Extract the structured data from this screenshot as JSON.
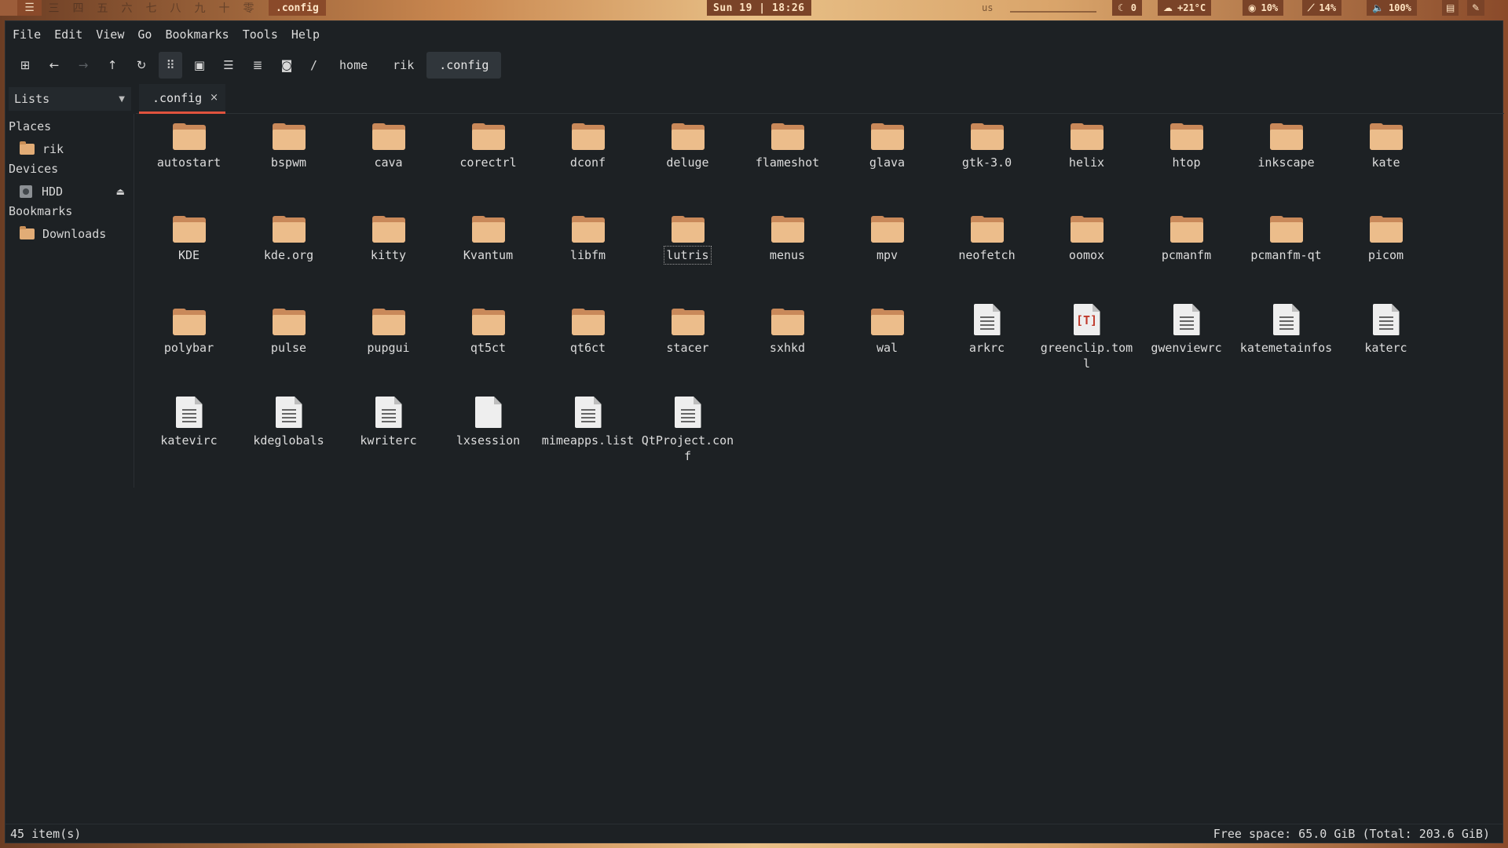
{
  "panel": {
    "workspaces": [
      "三",
      "四",
      "五",
      "六",
      "七",
      "八",
      "九",
      "十",
      "零"
    ],
    "window_title": ".config",
    "clock": "Sun 19 | 18:26",
    "keyboard": "us",
    "stats": [
      {
        "icon": "moon-icon",
        "glyph": "☾",
        "value": "0"
      },
      {
        "icon": "weather-icon",
        "glyph": "☁",
        "value": "+21°C"
      },
      {
        "icon": "cpu-icon",
        "glyph": "◉",
        "value": "10%"
      },
      {
        "icon": "memory-icon",
        "glyph": "⟋",
        "value": "14%"
      },
      {
        "icon": "volume-icon",
        "glyph": "🔈",
        "value": "100%"
      }
    ]
  },
  "menubar": {
    "file": "File",
    "edit": "Edit",
    "view": "View",
    "go": "Go",
    "bookmarks": "Bookmarks",
    "tools": "Tools",
    "help": "Help"
  },
  "toolbar": {
    "root": "/",
    "breadcrumbs": [
      "home",
      "rik",
      ".config"
    ]
  },
  "side": {
    "lists_label": "Lists",
    "places_heading": "Places",
    "places": [
      {
        "label": "rik"
      }
    ],
    "devices_heading": "Devices",
    "devices": [
      {
        "label": "HDD"
      }
    ],
    "bookmarks_heading": "Bookmarks",
    "bookmarks": [
      {
        "label": "Downloads"
      }
    ]
  },
  "tab": {
    "label": ".config",
    "close": "×"
  },
  "items": [
    {
      "name": "autostart",
      "type": "folder"
    },
    {
      "name": "bspwm",
      "type": "folder"
    },
    {
      "name": "cava",
      "type": "folder"
    },
    {
      "name": "corectrl",
      "type": "folder"
    },
    {
      "name": "dconf",
      "type": "folder"
    },
    {
      "name": "deluge",
      "type": "folder"
    },
    {
      "name": "flameshot",
      "type": "folder"
    },
    {
      "name": "glava",
      "type": "folder"
    },
    {
      "name": "gtk-3.0",
      "type": "folder"
    },
    {
      "name": "helix",
      "type": "folder"
    },
    {
      "name": "htop",
      "type": "folder"
    },
    {
      "name": "inkscape",
      "type": "folder"
    },
    {
      "name": "kate",
      "type": "folder"
    },
    {
      "name": "KDE",
      "type": "folder"
    },
    {
      "name": "kde.org",
      "type": "folder"
    },
    {
      "name": "kitty",
      "type": "folder"
    },
    {
      "name": "Kvantum",
      "type": "folder"
    },
    {
      "name": "libfm",
      "type": "folder"
    },
    {
      "name": "lutris",
      "type": "folder",
      "focused": true
    },
    {
      "name": "menus",
      "type": "folder"
    },
    {
      "name": "mpv",
      "type": "folder"
    },
    {
      "name": "neofetch",
      "type": "folder"
    },
    {
      "name": "oomox",
      "type": "folder"
    },
    {
      "name": "pcmanfm",
      "type": "folder"
    },
    {
      "name": "pcmanfm-qt",
      "type": "folder"
    },
    {
      "name": "picom",
      "type": "folder"
    },
    {
      "name": "polybar",
      "type": "folder"
    },
    {
      "name": "pulse",
      "type": "folder"
    },
    {
      "name": "pupgui",
      "type": "folder"
    },
    {
      "name": "qt5ct",
      "type": "folder"
    },
    {
      "name": "qt6ct",
      "type": "folder"
    },
    {
      "name": "stacer",
      "type": "folder"
    },
    {
      "name": "sxhkd",
      "type": "folder"
    },
    {
      "name": "wal",
      "type": "folder"
    },
    {
      "name": "arkrc",
      "type": "text"
    },
    {
      "name": "greenclip.toml",
      "type": "toml"
    },
    {
      "name": "gwenviewrc",
      "type": "text"
    },
    {
      "name": "katemetainfos",
      "type": "text"
    },
    {
      "name": "katerc",
      "type": "text"
    },
    {
      "name": "katevirc",
      "type": "text"
    },
    {
      "name": "kdeglobals",
      "type": "text"
    },
    {
      "name": "kwriterc",
      "type": "text"
    },
    {
      "name": "lxsession",
      "type": "blank"
    },
    {
      "name": "mimeapps.list",
      "type": "text"
    },
    {
      "name": "QtProject.conf",
      "type": "text"
    }
  ],
  "status": {
    "count": "45 item(s)",
    "free_space": "Free space: 65.0 GiB (Total: 203.6 GiB)"
  },
  "colors": {
    "accent": "#e0533d",
    "folder": "#ecbd8b",
    "background": "#1d2124"
  }
}
